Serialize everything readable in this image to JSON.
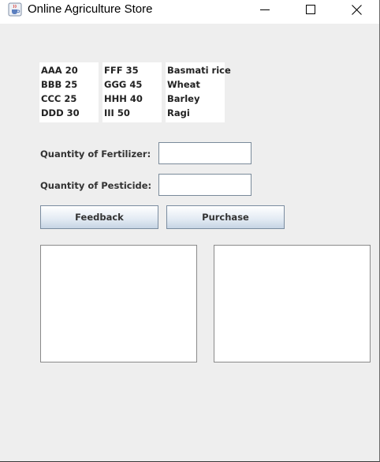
{
  "window": {
    "title": "Online Agriculture Store",
    "icons": [
      "java-cup-icon",
      "minimize-icon",
      "maximize-icon",
      "close-icon"
    ]
  },
  "lists": {
    "fertilizers": [
      "AAA 20",
      "BBB 25",
      "CCC 25",
      "DDD 30"
    ],
    "pesticides": [
      "FFF 35",
      "GGG 45",
      "HHH 40",
      "III 50"
    ],
    "crops": [
      "Basmati rice",
      "Wheat",
      "Barley",
      "Ragi"
    ]
  },
  "form": {
    "fertilizer_label": "Quantity of Fertilizer:",
    "pesticide_label": "Quantity of Pesticide:",
    "fertilizer_value": "",
    "pesticide_value": ""
  },
  "buttons": {
    "feedback": "Feedback",
    "purchase": "Purchase"
  },
  "output": {
    "left_text": "",
    "right_text": ""
  },
  "colors": {
    "background": "#eeeeee",
    "button_gradient_top": "#ffffff",
    "button_gradient_bottom": "#c6d4e4",
    "button_border": "#7a8ca0"
  }
}
